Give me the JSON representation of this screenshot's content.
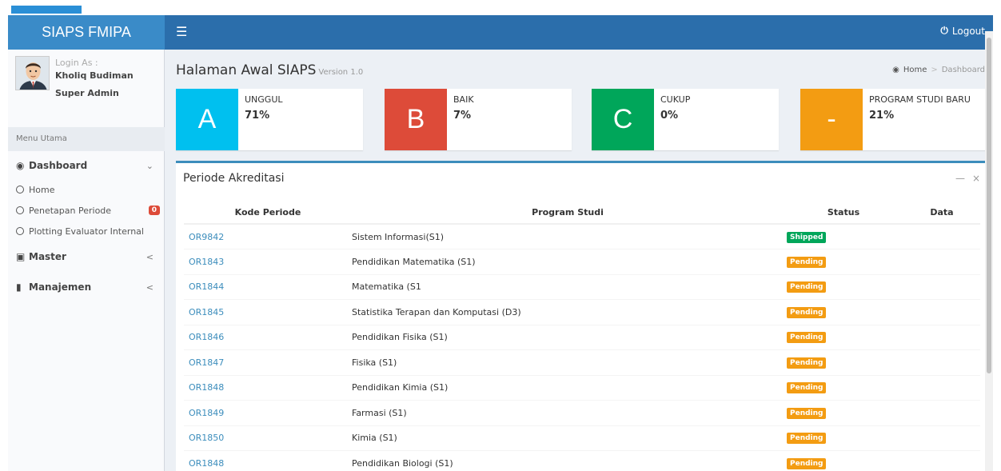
{
  "app": {
    "title": "SIAPS FMIPA",
    "logout_label": "Logout"
  },
  "user": {
    "login_as": "Login As :",
    "name": "Kholiq Budiman",
    "role": "Super Admin"
  },
  "sidebar": {
    "menu_header": "Menu Utama",
    "dashboard": "Dashboard",
    "sub_items": [
      {
        "label": "Home"
      },
      {
        "label": "Penetapan Periode",
        "badge": "0"
      },
      {
        "label": "Plotting Evaluator Internal"
      }
    ],
    "master": "Master",
    "manajemen": "Manajemen"
  },
  "page": {
    "title": "Halaman Awal SIAPS",
    "version": "Version 1.0"
  },
  "breadcrumb": {
    "home": "Home",
    "current": "Dashboard",
    "separator": ">"
  },
  "info_boxes": [
    {
      "letter": "A",
      "label": "UNGGUL",
      "value": "71%",
      "color": "#00c0ef"
    },
    {
      "letter": "B",
      "label": "BAIK",
      "value": "7%",
      "color": "#dd4b39"
    },
    {
      "letter": "C",
      "label": "CUKUP",
      "value": "0%",
      "color": "#00a65a"
    },
    {
      "letter": "-",
      "label": "PROGRAM STUDI BARU",
      "value": "21%",
      "color": "#f39c12"
    }
  ],
  "periode": {
    "title": "Periode Akreditasi",
    "columns": [
      "Kode Periode",
      "Program Studi",
      "Status",
      "Data"
    ],
    "rows": [
      {
        "kode": "OR9842",
        "program": "Sistem Informasi(S1)",
        "status": "Shipped"
      },
      {
        "kode": "OR1843",
        "program": "Pendidikan Matematika (S1)",
        "status": "Pending"
      },
      {
        "kode": "OR1844",
        "program": "Matematika (S1",
        "status": "Pending"
      },
      {
        "kode": "OR1845",
        "program": "Statistika Terapan dan Komputasi (D3)",
        "status": "Pending"
      },
      {
        "kode": "OR1846",
        "program": "Pendidikan Fisika (S1)",
        "status": "Pending"
      },
      {
        "kode": "OR1847",
        "program": "Fisika (S1)",
        "status": "Pending"
      },
      {
        "kode": "OR1848",
        "program": "Pendidikan Kimia (S1)",
        "status": "Pending"
      },
      {
        "kode": "OR1849",
        "program": "Farmasi (S1)",
        "status": "Pending"
      },
      {
        "kode": "OR1850",
        "program": "Kimia (S1)",
        "status": "Pending"
      },
      {
        "kode": "OR1848",
        "program": "Pendidikan Biologi (S1)",
        "status": "Pending"
      }
    ]
  },
  "status_colors": {
    "Shipped": "#00a65a",
    "Pending": "#f39c12"
  },
  "icons": {
    "menu": "hamburger-icon",
    "power": "power-icon",
    "dashboard": "dashboard-icon",
    "master": "archive-icon",
    "manajemen": "book-icon",
    "circle": "circle-icon",
    "minus": "minus-icon",
    "close": "close-icon"
  }
}
